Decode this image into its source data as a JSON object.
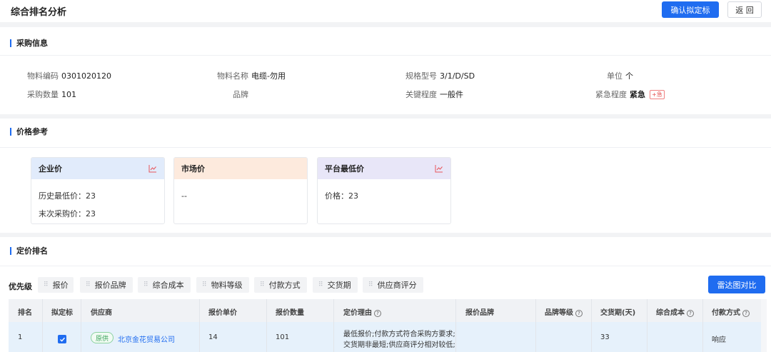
{
  "header": {
    "title": "综合排名分析",
    "confirm_button": "确认拟定标",
    "back_button": "返 回"
  },
  "purchase_info": {
    "section_title": "采购信息",
    "fields": [
      {
        "label": "物料编码",
        "value": "0301020120"
      },
      {
        "label": "物料名称",
        "value": "电缆-勿用"
      },
      {
        "label": "规格型号",
        "value": "3/1/D/SD"
      },
      {
        "label": "单位",
        "value": "个"
      },
      {
        "label": "采购数量",
        "value": "101"
      },
      {
        "label": "品牌",
        "value": ""
      },
      {
        "label": "关键程度",
        "value": "一般件"
      },
      {
        "label": "紧急程度",
        "value": "紧急",
        "tag": "+急"
      }
    ]
  },
  "price_ref": {
    "section_title": "价格参考",
    "cards": [
      {
        "title": "企业价",
        "color": "#e1ebfb",
        "icon": "trend-chart-icon",
        "lines": [
          "历史最低价：23",
          "末次采购价：23"
        ]
      },
      {
        "title": "市场价",
        "color": "#fdeadd",
        "lines": [
          "--"
        ]
      },
      {
        "title": "平台最低价",
        "color": "#e8e6f8",
        "icon": "trend-chart-icon",
        "lines": [
          "价格：23"
        ]
      }
    ]
  },
  "ranking": {
    "section_title": "定价排名",
    "priority_label": "优先级",
    "chips": [
      "报价",
      "报价品牌",
      "综合成本",
      "物料等级",
      "付款方式",
      "交货期",
      "供应商评分"
    ],
    "radar_button": "雷达图对比",
    "columns": [
      "排名",
      "拟定标",
      "供应商",
      "报价单价",
      "报价数量",
      "定价理由",
      "报价品牌",
      "品牌等级",
      "交货期(天)",
      "综合成本",
      "付款方式"
    ],
    "rows": [
      {
        "rank": "1",
        "selected": true,
        "badge": "原供",
        "supplier": "北京金花贸易公司",
        "unit_price": "14",
        "quantity": "101",
        "reason_line1": "最低报价;付款方式符合采购方要求;",
        "reason_line2": "交货期非最短;供应商评分相对较低;",
        "brand": "",
        "brand_level": "",
        "delivery_days": "33",
        "total_cost": "",
        "payment": "响应"
      }
    ]
  },
  "colors": {
    "primary": "#1f6cf0",
    "link": "#1f6cf0",
    "accent_red": "#e8555b",
    "badge_green": "#3aa35a"
  }
}
